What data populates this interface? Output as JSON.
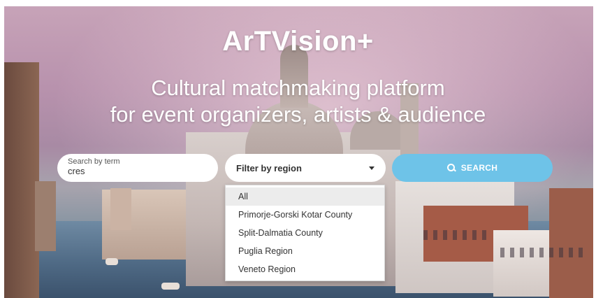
{
  "hero": {
    "title": "ArTVision+",
    "subtitle_line1": "Cultural matchmaking platform",
    "subtitle_line2": "for event organizers, artists & audience"
  },
  "search": {
    "term_label": "Search by term",
    "term_value": "cres",
    "region_placeholder": "Filter by region",
    "button_label": "SEARCH",
    "button_icon": "search-icon"
  },
  "region_dropdown": {
    "options": [
      "All",
      "Primorje-Gorski Kotar County",
      "Split-Dalmatia County",
      "Puglia Region",
      "Veneto Region"
    ],
    "highlighted": "All"
  },
  "colors": {
    "button": "#6ec3e8",
    "text_on_hero": "#ffffff"
  }
}
